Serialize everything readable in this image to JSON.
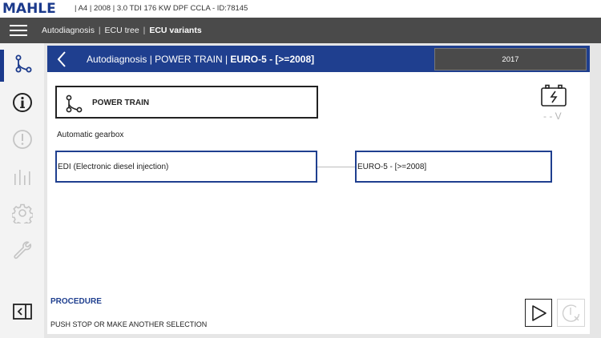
{
  "brand": {
    "logo_text": "MAHLE"
  },
  "vehicle": {
    "info": "| A4 | 2008 | 3.0 TDI 176 KW DPF CCLA   - ID:78145"
  },
  "navbar": {
    "crumbs": [
      "Autodiagnosis",
      "ECU tree"
    ],
    "separator": "|",
    "current": "ECU variants"
  },
  "sidebar": {
    "items": [
      {
        "icon": "tree-icon",
        "active": true
      },
      {
        "icon": "info-icon",
        "active": false
      },
      {
        "icon": "warning-icon",
        "active": false
      },
      {
        "icon": "bar-chart-icon",
        "active": false
      },
      {
        "icon": "gear-icon",
        "active": false
      },
      {
        "icon": "wrench-icon",
        "active": false
      }
    ],
    "collapse_icon": "collapse-icon"
  },
  "panel": {
    "title_prefix": "Autodiagnosis | POWER TRAIN | ",
    "title_bold": "EURO-5 - [>=2008]",
    "year": "2017",
    "system_label": "POWER TRAIN",
    "voltage": "- - V",
    "section_label": "Automatic gearbox",
    "nodes": {
      "left": "EDI (Electronic diesel injection)",
      "right": "EURO-5 - [>=2008]"
    },
    "procedure_title": "PROCEDURE",
    "procedure_text": "PUSH STOP OR MAKE ANOTHER SELECTION"
  },
  "colors": {
    "brand_blue": "#1b3a8c",
    "header_blue": "#1f3f8f",
    "navbar_gray": "#4a4a4a",
    "background": "#e6e6e6"
  }
}
